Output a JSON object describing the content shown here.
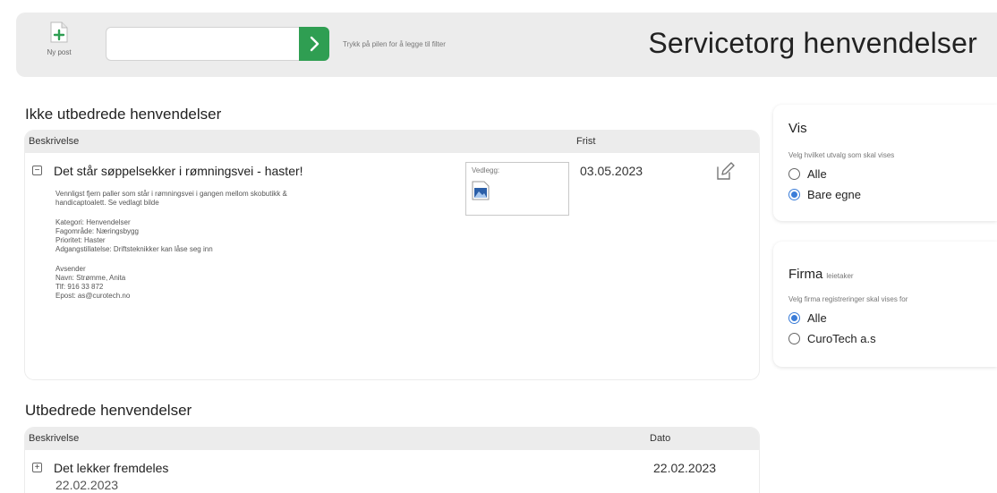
{
  "toolbar": {
    "new_post_label": "Ny post",
    "filter_value": "",
    "filter_hint": "Trykk på pilen for å legge til filter",
    "page_title": "Servicetorg henvendelser"
  },
  "open_section": {
    "title": "Ikke utbedrede henvendelser",
    "columns": {
      "description": "Beskrivelse",
      "deadline": "Frist"
    },
    "rows": [
      {
        "title": "Det står søppelsekker i rømningsvei - haster!",
        "date": "03.05.2023",
        "attachment_label": "Vedlegg:",
        "details": {
          "line1": "Vennligst fjern paller som står i rømningsvei i gangen mellom skobutikk &",
          "line2": "handicaptoalett. Se vedlagt bilde",
          "category": "Kategori: Henvendelser",
          "area": "Fagområde: Næringsbygg",
          "priority": "Prioritet: Haster",
          "access": "Adgangstillatelse: Driftsteknikker kan låse seg inn",
          "sender_heading": "Avsender",
          "name": "Navn: Strømme, Anita",
          "phone": "Tlf: 916 33 872",
          "email": "Epost: as@curotech.no"
        }
      }
    ]
  },
  "done_section": {
    "title": "Utbedrede henvendelser",
    "columns": {
      "description": "Beskrivelse",
      "date": "Dato"
    },
    "rows": [
      {
        "title": "Det lekker fremdeles",
        "date": "22.02.2023",
        "subdate": "22.02.2023"
      }
    ]
  },
  "show_panel": {
    "title": "Vis",
    "subtitle": "Velg hvilket utvalg som skal vises",
    "options": [
      {
        "label": "Alle",
        "selected": false
      },
      {
        "label": "Bare egne",
        "selected": true
      }
    ]
  },
  "company_panel": {
    "title": "Firma",
    "title_suffix": "leietaker",
    "subtitle": "Velg firma registreringer skal vises for",
    "options": [
      {
        "label": "Alle",
        "selected": true
      },
      {
        "label": "CuroTech a.s",
        "selected": false
      }
    ]
  },
  "colors": {
    "accent_green": "#2f9e52",
    "radio_blue": "#3b7dd8",
    "header_gray": "#ececec"
  },
  "icons": {
    "new_post": "new-document-icon",
    "filter_go": "chevron-right-icon",
    "edit": "pencil-icon",
    "collapse": "minus-square-icon",
    "expand": "plus-square-icon",
    "attachment": "image-icon"
  }
}
